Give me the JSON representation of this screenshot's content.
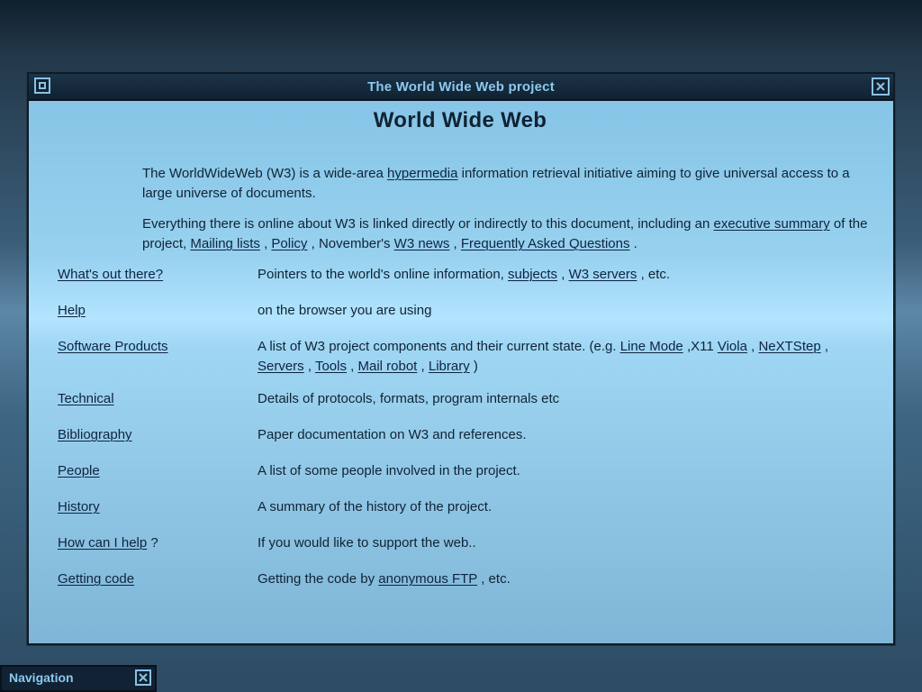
{
  "window": {
    "title": "The World Wide Web project"
  },
  "page": {
    "heading": "World Wide Web",
    "intro_1": {
      "before_link": "The WorldWideWeb (W3) is a wide-area",
      "link_text": "hypermedia",
      "after_link": "information retrieval initiative aiming to give universal access to a large universe of documents."
    },
    "intro_2": {
      "before_link": "Everything there is online about W3 is linked directly or indirectly to this document, including an",
      "link_1": "executive summary",
      "text_1": "of the project,",
      "link_2": "Mailing lists",
      "text_2": ",",
      "link_3": "Policy",
      "text_3": ", November's",
      "link_4": "W3 news",
      "text_4": ",",
      "link_5": "Frequently Asked Questions",
      "text_5": "."
    },
    "index": [
      {
        "left_link": "What's out there?",
        "right_text_1": "Pointers to the world's online information,",
        "right_link_1": "subjects",
        "right_text_2": ",",
        "right_link_2": "W3 servers",
        "right_text_3": ", etc."
      },
      {
        "left_link": "Help",
        "right_text_1": "on the browser you are using"
      },
      {
        "left_link": "Software Products",
        "right_text_1": "A list of W3 project components and their current state. (e.g.",
        "right_link_1": "Line Mode",
        "right_text_2": ",X11",
        "right_link_2": "Viola",
        "right_text_3": ",",
        "right_link_3": "NeXTStep",
        "right_text_4": ",",
        "right_link_4": "Servers",
        "right_text_5": ",",
        "right_link_5": "Tools",
        "right_text_6": ",",
        "right_link_6": "Mail robot",
        "right_text_7": ",",
        "right_link_7": "Library",
        "right_text_8": ")"
      },
      {
        "left_link": "Technical",
        "right_text_1": "Details of protocols, formats, program internals etc"
      },
      {
        "left_link": "Bibliography",
        "right_text_1": "Paper documentation on  W3 and references."
      },
      {
        "left_link": "People",
        "right_text_1": "A list of some people involved in the project."
      },
      {
        "left_link": "History",
        "right_text_1": "A summary of the history of the project."
      },
      {
        "left_link": "How can I help",
        "left_suffix": "?",
        "right_text_1": "If you would like to support the web.."
      },
      {
        "left_link": "Getting code",
        "right_text_1": "Getting the code by",
        "right_link_1": "anonymous FTP",
        "right_text_2": ", etc."
      }
    ]
  },
  "navigation_window": {
    "title": "Navigation"
  },
  "icons": {
    "window_menu": "window-menu-icon",
    "window_close": "close-icon",
    "navigation_close": "close-icon"
  }
}
